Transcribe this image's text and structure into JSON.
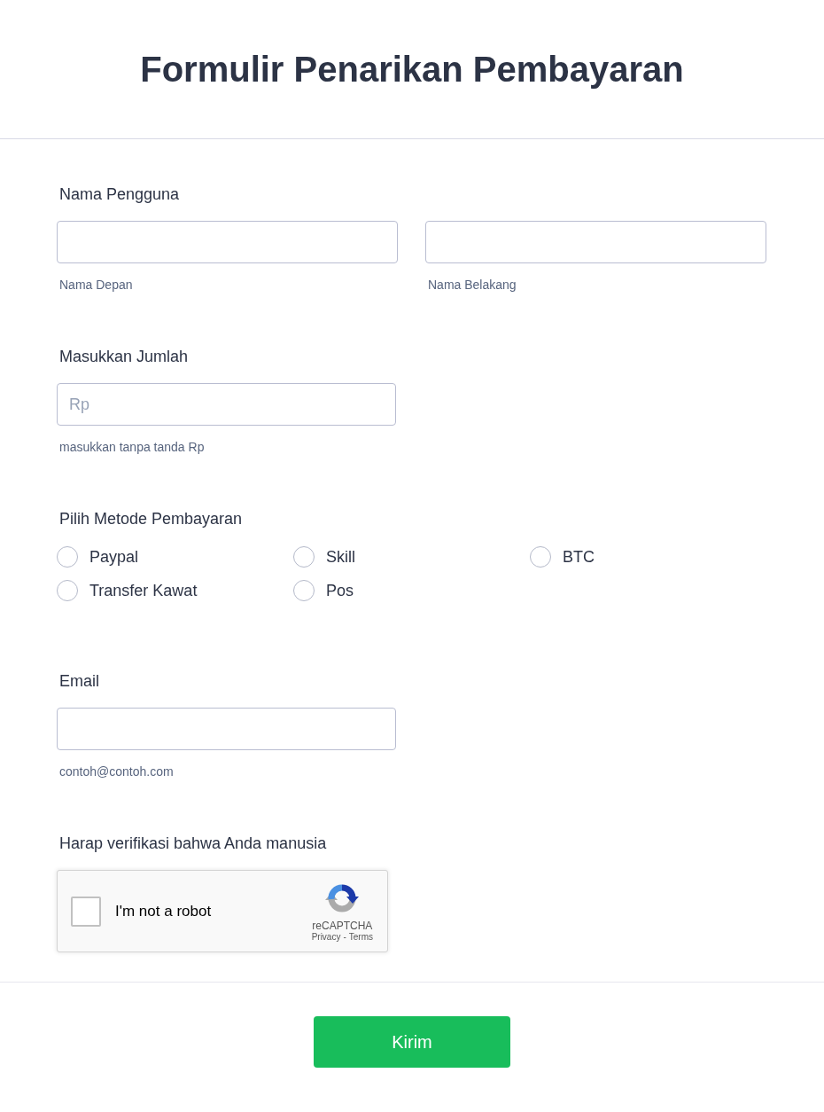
{
  "header": {
    "title": "Formulir Penarikan Pembayaran"
  },
  "fields": [
    {
      "kind": "name",
      "label": "Nama Pengguna",
      "inputs": [
        {
          "sublabel": "Nama Depan"
        },
        {
          "sublabel": "Nama Belakang"
        }
      ]
    },
    {
      "kind": "text",
      "label": "Masukkan Jumlah",
      "placeholder": "Rp",
      "sublabel": "masukkan tanpa tanda Rp"
    },
    {
      "kind": "radio",
      "label": "Pilih Metode Pembayaran",
      "options": [
        {
          "label": "Paypal",
          "selected": false
        },
        {
          "label": "Skill",
          "selected": false
        },
        {
          "label": "BTC",
          "selected": false
        },
        {
          "label": "Transfer Kawat",
          "selected": false
        },
        {
          "label": "Pos",
          "selected": false
        }
      ]
    },
    {
      "kind": "text",
      "label": "Email",
      "sublabel": "contoh@contoh.com"
    },
    {
      "kind": "captcha",
      "label": "Harap verifikasi bahwa Anda manusia",
      "captcha": {
        "checked": false,
        "text": "I'm not a robot",
        "brand": "reCAPTCHA",
        "links": [
          {
            "label": "Privacy"
          },
          {
            "label": "Terms"
          }
        ],
        "separator": "-"
      }
    }
  ],
  "submit": {
    "label": "Kirim"
  }
}
